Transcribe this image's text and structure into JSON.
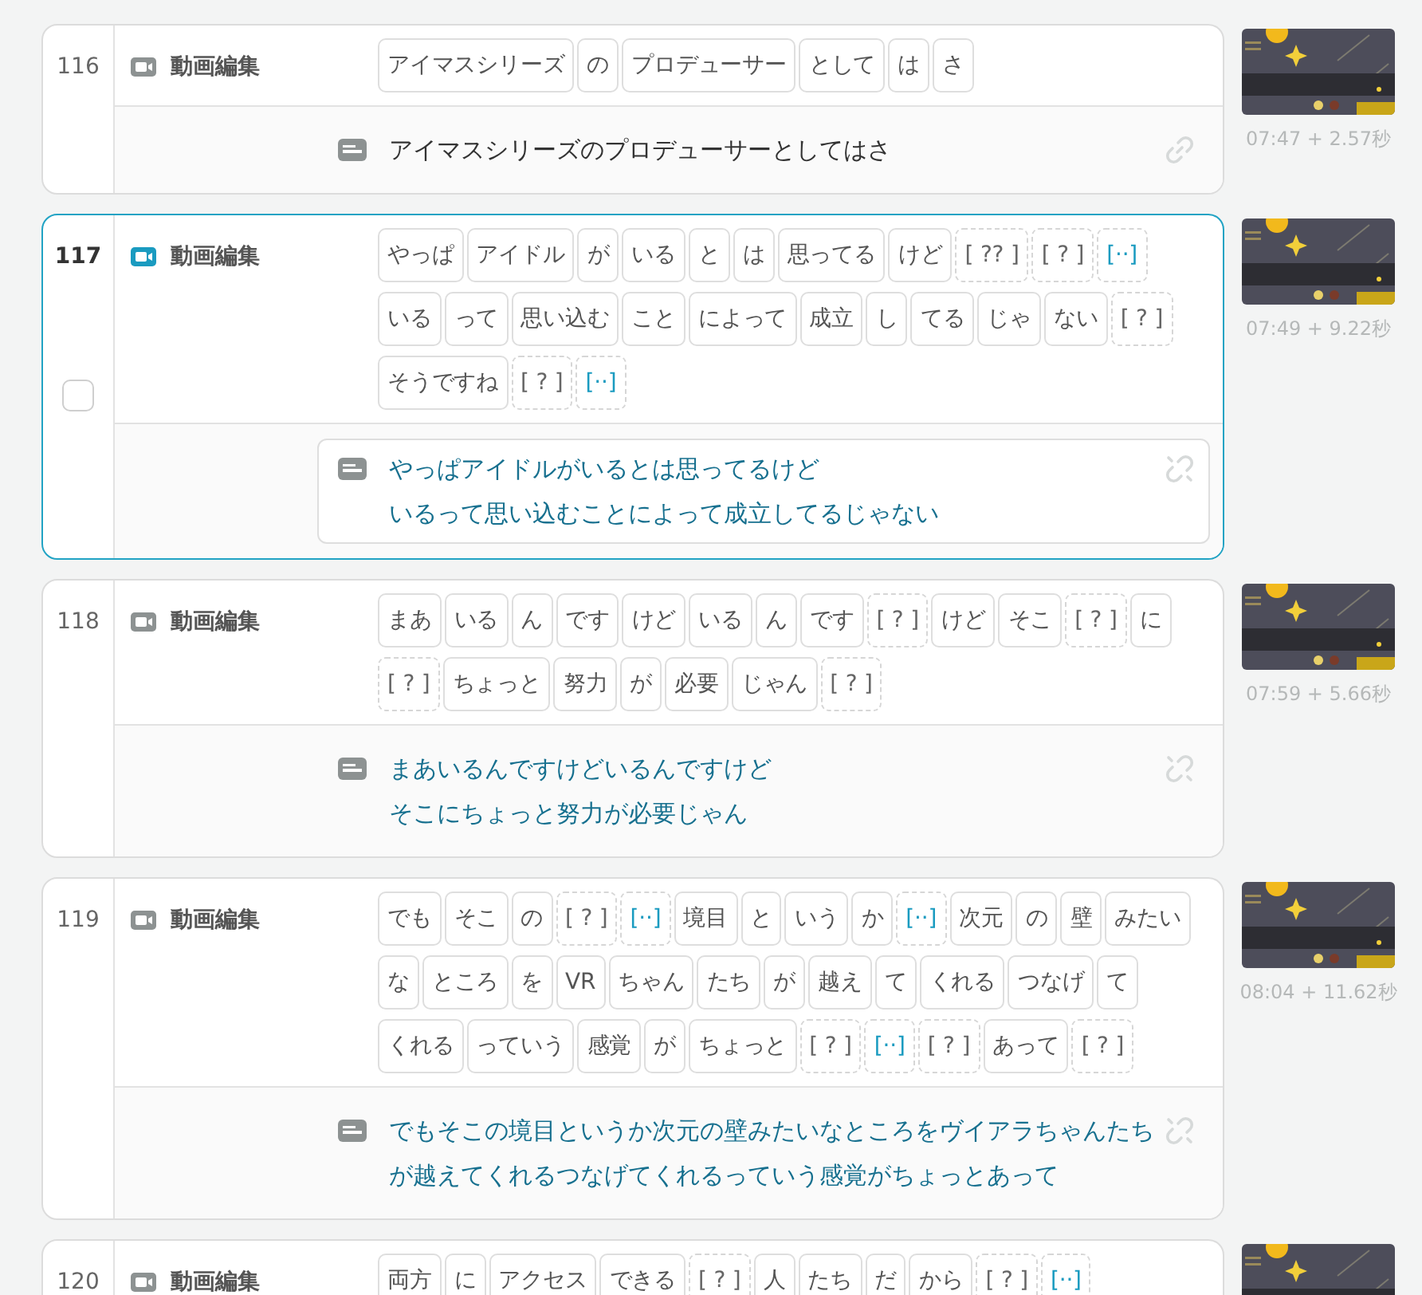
{
  "clips": [
    {
      "number": "116",
      "selected": false,
      "track_label": "動画編集",
      "linked": true,
      "tokens": [
        {
          "text": "アイマスシリーズ",
          "kind": "word"
        },
        {
          "text": "の",
          "kind": "word"
        },
        {
          "text": "プロデューサー",
          "kind": "word"
        },
        {
          "text": "として",
          "kind": "word"
        },
        {
          "text": "は",
          "kind": "word"
        },
        {
          "text": "さ",
          "kind": "word"
        }
      ],
      "subtitle_lines": [
        "アイマスシリーズのプロデューサーとしてはさ"
      ],
      "thumbnail": {
        "kind": "picture"
      },
      "timing": "07:47 + 2.57秒"
    },
    {
      "number": "117",
      "selected": true,
      "checked": false,
      "track_label": "動画編集",
      "linked": false,
      "tokens": [
        {
          "text": "やっぱ",
          "kind": "word"
        },
        {
          "text": "アイドル",
          "kind": "word"
        },
        {
          "text": "が",
          "kind": "word"
        },
        {
          "text": "いる",
          "kind": "word"
        },
        {
          "text": "と",
          "kind": "word"
        },
        {
          "text": "は",
          "kind": "word"
        },
        {
          "text": "思ってる",
          "kind": "word"
        },
        {
          "text": "けど",
          "kind": "word"
        },
        {
          "text": "[ ?? ]",
          "kind": "unknown"
        },
        {
          "text": "[ ? ]",
          "kind": "unknown"
        },
        {
          "text": "[··]",
          "kind": "pause"
        },
        {
          "text": "いる",
          "kind": "word"
        },
        {
          "text": "って",
          "kind": "word"
        },
        {
          "text": "思い込む",
          "kind": "word"
        },
        {
          "text": "こと",
          "kind": "word"
        },
        {
          "text": "によって",
          "kind": "word"
        },
        {
          "text": "成立",
          "kind": "word"
        },
        {
          "text": "し",
          "kind": "word"
        },
        {
          "text": "てる",
          "kind": "word"
        },
        {
          "text": "じゃ",
          "kind": "word"
        },
        {
          "text": "ない",
          "kind": "word"
        },
        {
          "text": "[ ? ]",
          "kind": "unknown"
        },
        {
          "text": "そうですね",
          "kind": "word"
        },
        {
          "text": "[ ? ]",
          "kind": "unknown"
        },
        {
          "text": "[··]",
          "kind": "pause"
        }
      ],
      "subtitle_lines": [
        "やっぱアイドルがいるとは思ってるけど",
        "いるって思い込むことによって成立してるじゃない"
      ],
      "thumbnail": {
        "kind": "picture"
      },
      "timing": "07:49 + 9.22秒"
    },
    {
      "number": "118",
      "selected": false,
      "track_label": "動画編集",
      "linked": false,
      "tokens": [
        {
          "text": "まあ",
          "kind": "word"
        },
        {
          "text": "いる",
          "kind": "word"
        },
        {
          "text": "ん",
          "kind": "word"
        },
        {
          "text": "です",
          "kind": "word"
        },
        {
          "text": "けど",
          "kind": "word"
        },
        {
          "text": "いる",
          "kind": "word"
        },
        {
          "text": "ん",
          "kind": "word"
        },
        {
          "text": "です",
          "kind": "word"
        },
        {
          "text": "[ ? ]",
          "kind": "unknown"
        },
        {
          "text": "けど",
          "kind": "word"
        },
        {
          "text": "そこ",
          "kind": "word"
        },
        {
          "text": "[ ? ]",
          "kind": "unknown"
        },
        {
          "text": "に",
          "kind": "word"
        },
        {
          "text": "[ ? ]",
          "kind": "unknown"
        },
        {
          "text": "ちょっと",
          "kind": "word"
        },
        {
          "text": "努力",
          "kind": "word"
        },
        {
          "text": "が",
          "kind": "word"
        },
        {
          "text": "必要",
          "kind": "word"
        },
        {
          "text": "じゃん",
          "kind": "word"
        },
        {
          "text": "[ ? ]",
          "kind": "unknown"
        }
      ],
      "subtitle_lines": [
        "まあいるんですけどいるんですけど",
        "そこにちょっと努力が必要じゃん"
      ],
      "thumbnail": {
        "kind": "picture"
      },
      "timing": "07:59 + 5.66秒"
    },
    {
      "number": "119",
      "selected": false,
      "track_label": "動画編集",
      "linked": false,
      "tokens": [
        {
          "text": "でも",
          "kind": "word"
        },
        {
          "text": "そこ",
          "kind": "word"
        },
        {
          "text": "の",
          "kind": "word"
        },
        {
          "text": "[ ? ]",
          "kind": "unknown"
        },
        {
          "text": "[··]",
          "kind": "pause"
        },
        {
          "text": "境目",
          "kind": "word"
        },
        {
          "text": "と",
          "kind": "word"
        },
        {
          "text": "いう",
          "kind": "word"
        },
        {
          "text": "か",
          "kind": "word"
        },
        {
          "text": "[··]",
          "kind": "pause"
        },
        {
          "text": "次元",
          "kind": "word"
        },
        {
          "text": "の",
          "kind": "word"
        },
        {
          "text": "壁",
          "kind": "word"
        },
        {
          "text": "みたい",
          "kind": "word"
        },
        {
          "text": "な",
          "kind": "word"
        },
        {
          "text": "ところ",
          "kind": "word"
        },
        {
          "text": "を",
          "kind": "word"
        },
        {
          "text": "VR",
          "kind": "word"
        },
        {
          "text": "ちゃん",
          "kind": "word"
        },
        {
          "text": "たち",
          "kind": "word"
        },
        {
          "text": "が",
          "kind": "word"
        },
        {
          "text": "越え",
          "kind": "word"
        },
        {
          "text": "て",
          "kind": "word"
        },
        {
          "text": "くれる",
          "kind": "word"
        },
        {
          "text": "つなげ",
          "kind": "word"
        },
        {
          "text": "て",
          "kind": "word"
        },
        {
          "text": "くれる",
          "kind": "word"
        },
        {
          "text": "っていう",
          "kind": "word"
        },
        {
          "text": "感覚",
          "kind": "word"
        },
        {
          "text": "が",
          "kind": "word"
        },
        {
          "text": "ちょっと",
          "kind": "word"
        },
        {
          "text": "[ ? ]",
          "kind": "unknown"
        },
        {
          "text": "[··]",
          "kind": "pause"
        },
        {
          "text": "[ ? ]",
          "kind": "unknown"
        },
        {
          "text": "あって",
          "kind": "word"
        },
        {
          "text": "[ ? ]",
          "kind": "unknown"
        }
      ],
      "subtitle_lines": [
        "でもそこの境目というか次元の壁みたいなところをヴイアラちゃんたち",
        "が越えてくれるつなげてくれるっていう感覚がちょっとあって"
      ],
      "thumbnail": {
        "kind": "picture"
      },
      "timing": "08:04 + 11.62秒"
    },
    {
      "number": "120",
      "selected": false,
      "track_label": "動画編集",
      "tokens": [
        {
          "text": "両方",
          "kind": "word"
        },
        {
          "text": "に",
          "kind": "word"
        },
        {
          "text": "アクセス",
          "kind": "word"
        },
        {
          "text": "できる",
          "kind": "word"
        },
        {
          "text": "[ ? ]",
          "kind": "unknown"
        },
        {
          "text": "人",
          "kind": "word"
        },
        {
          "text": "たち",
          "kind": "word"
        },
        {
          "text": "だ",
          "kind": "word"
        },
        {
          "text": "から",
          "kind": "word"
        },
        {
          "text": "[ ? ]",
          "kind": "unknown"
        },
        {
          "text": "[··]",
          "kind": "pause"
        }
      ],
      "thumbnail": {
        "kind": "picture"
      }
    }
  ]
}
